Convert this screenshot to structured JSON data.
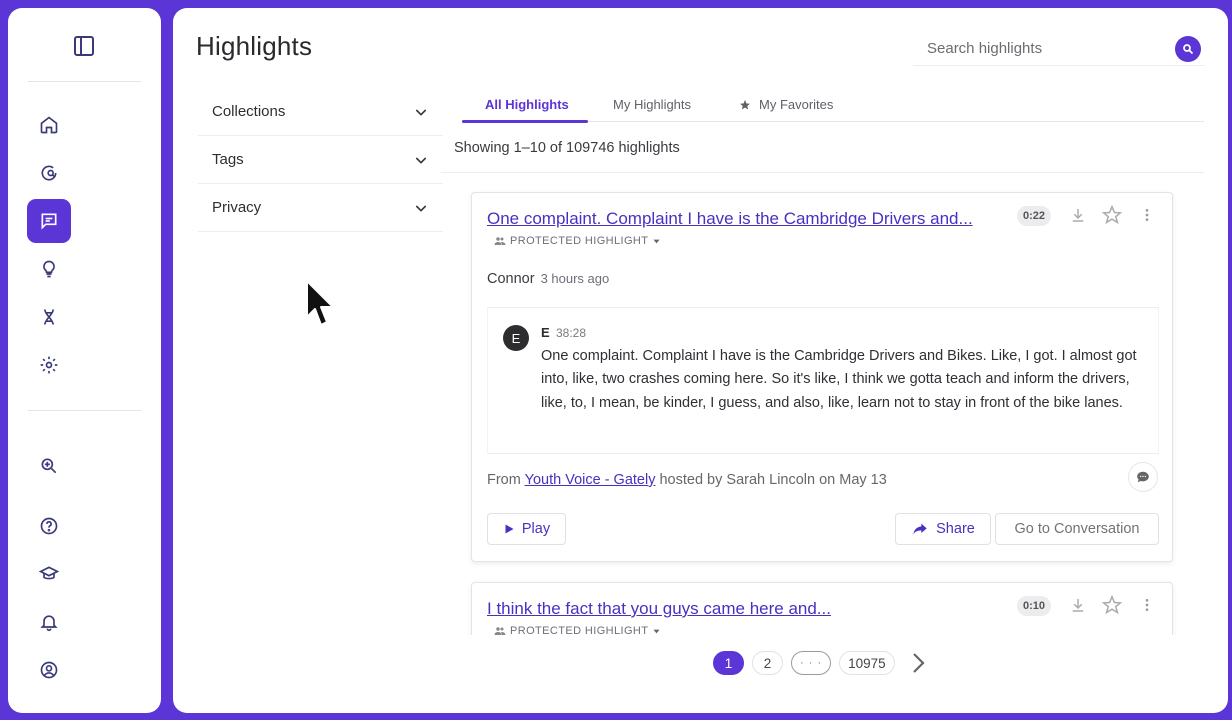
{
  "colors": {
    "brand": "#5b35d5",
    "link": "#4a2fc2"
  },
  "sidebar": {
    "top_icon": "sidebar-toggle-icon",
    "items": [
      {
        "name": "home",
        "icon": "home-icon"
      },
      {
        "name": "search-conversations",
        "icon": "chat-search-icon"
      },
      {
        "name": "highlights",
        "icon": "highlight-message-icon",
        "active": true
      },
      {
        "name": "insights",
        "icon": "lightbulb-icon"
      },
      {
        "name": "dna",
        "icon": "dna-icon"
      },
      {
        "name": "settings",
        "icon": "gear-icon"
      },
      {
        "name": "explore",
        "icon": "zoom-in-icon"
      },
      {
        "name": "help",
        "icon": "help-circle-icon"
      },
      {
        "name": "learn",
        "icon": "graduation-cap-icon"
      },
      {
        "name": "notifications",
        "icon": "bell-icon"
      },
      {
        "name": "account",
        "icon": "user-circle-icon"
      }
    ]
  },
  "header": {
    "title": "Highlights",
    "search_placeholder": "Search highlights"
  },
  "filters": {
    "collections": "Collections",
    "tags": "Tags",
    "privacy": "Privacy"
  },
  "tabs": {
    "all": "All Highlights",
    "mine": "My Highlights",
    "favorites": "My Favorites"
  },
  "results": {
    "showing": "Showing 1–10 of 109746 highlights"
  },
  "highlights": [
    {
      "title": "One complaint. Complaint I have is the Cambridge Drivers and...",
      "duration": "0:22",
      "privacy": "PROTECTED HIGHLIGHT",
      "author": "Connor",
      "time_ago": "3 hours ago",
      "speaker_initial": "E",
      "speaker_name": "E",
      "speaker_time": "38:28",
      "quote": "One complaint. Complaint I have is the Cambridge Drivers and Bikes. Like, I got. I almost got into, like, two crashes coming here. So it's like, I think we gotta teach and inform the drivers, like, to, I mean, be kinder, I guess, and also, like, learn not to stay in front of the bike lanes.",
      "from_prefix": "From ",
      "source": "Youth Voice - Gately",
      "from_suffix": " hosted by Sarah Lincoln on May 13",
      "play_label": "Play",
      "share_label": "Share",
      "goto_label": "Go to Conversation"
    },
    {
      "title": "I think the fact that you guys came here and...",
      "duration": "0:10",
      "privacy": "PROTECTED HIGHLIGHT"
    }
  ],
  "pagination": {
    "pages": [
      "1",
      "2"
    ],
    "ellipsis": "· · ·",
    "last": "10975"
  }
}
